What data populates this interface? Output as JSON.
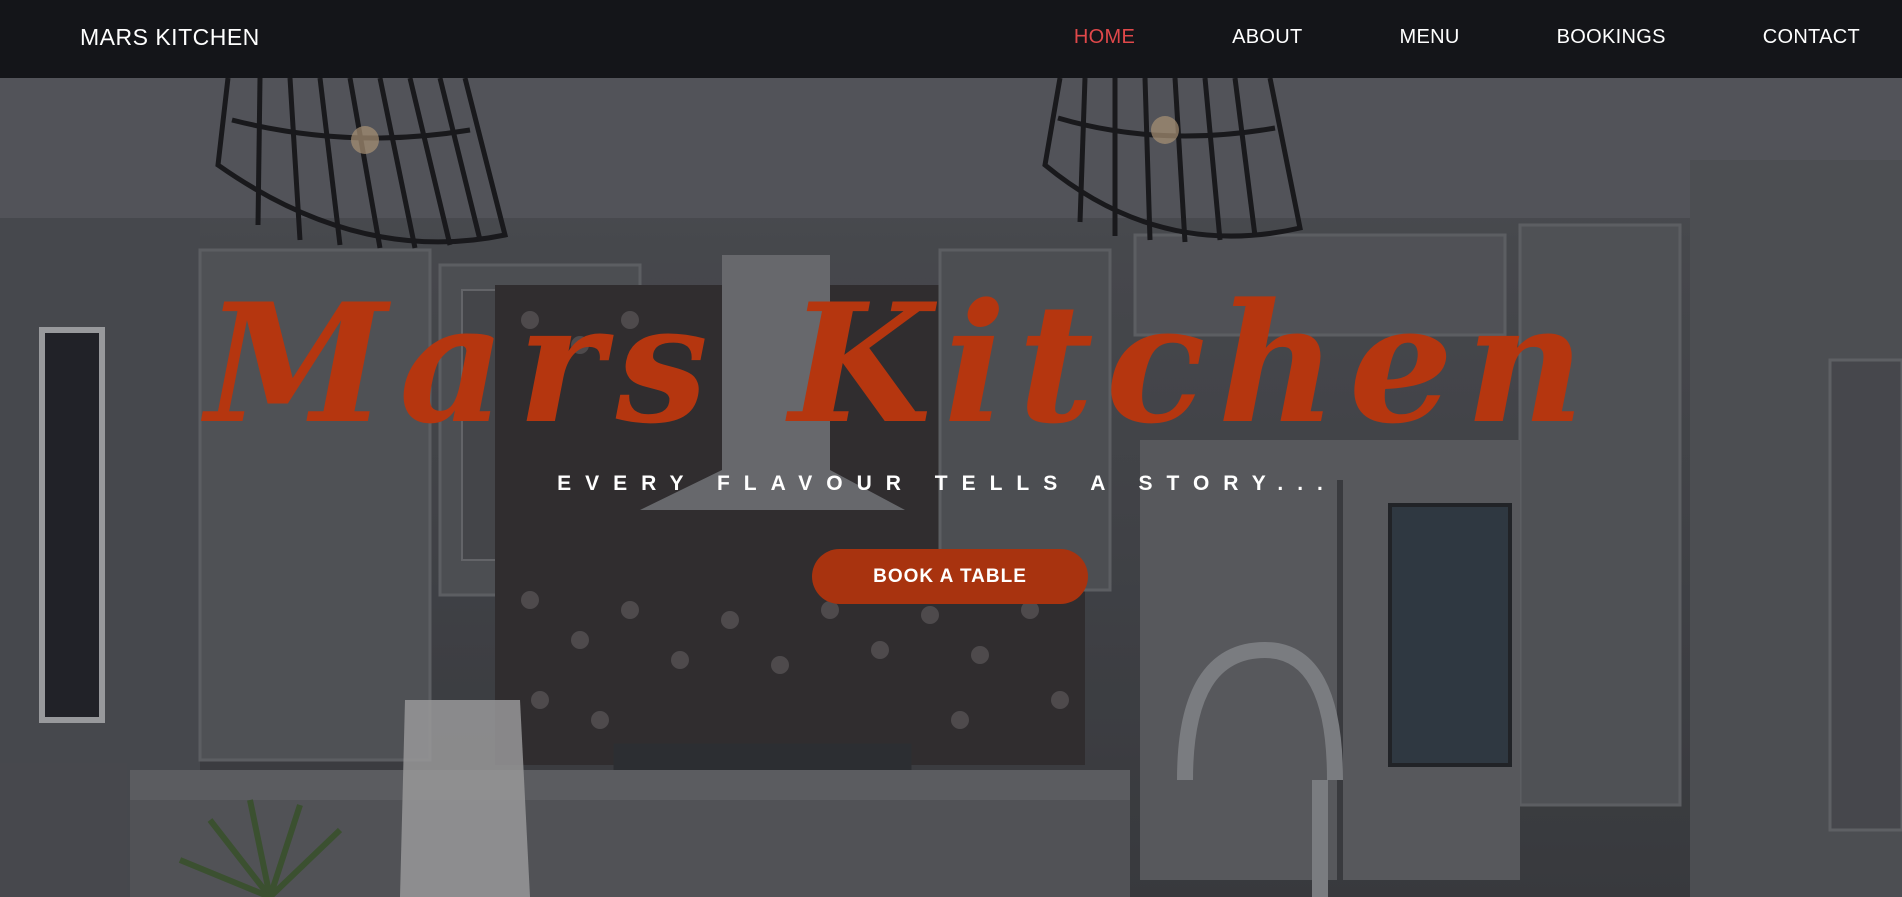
{
  "navbar": {
    "brand": "MARS KITCHEN",
    "links": [
      {
        "label": "HOME",
        "active": true
      },
      {
        "label": "ABOUT",
        "active": false
      },
      {
        "label": "MENU",
        "active": false
      },
      {
        "label": "BOOKINGS",
        "active": false
      },
      {
        "label": "CONTACT",
        "active": false
      }
    ]
  },
  "hero": {
    "title": "Mars Kitchen",
    "subtitle": "EVERY FLAVOUR TELLS A STORY...",
    "button_label": "BOOK A TABLE",
    "background_image": "kitchen-interior"
  },
  "colors": {
    "navbar_bg": "#141519",
    "active_link": "#e0484a",
    "accent": "#b5360f",
    "button_bg": "#a8330f",
    "text": "#ffffff"
  }
}
